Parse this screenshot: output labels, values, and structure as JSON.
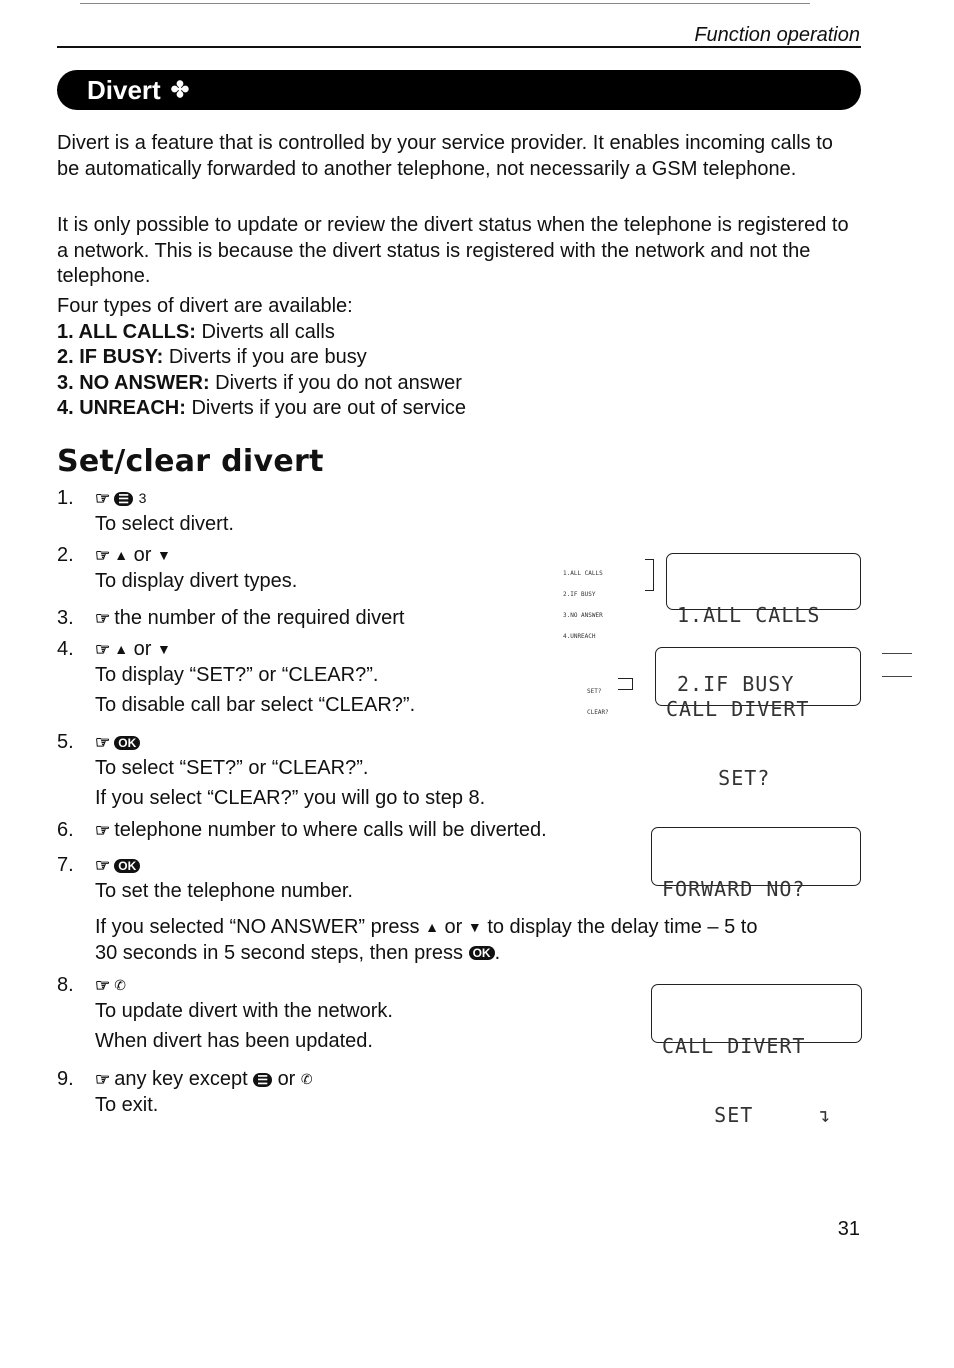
{
  "header": {
    "section": "Function operation",
    "banner_title": "Divert",
    "banner_icon": "divert-icon"
  },
  "intro": {
    "p1": "Divert is a feature that is controlled by your service provider. It enables incoming calls to be automatically forwarded to another telephone, not necessarily a GSM telephone.",
    "p2": "It is only possible to update or review the divert status when the telephone is registered to a network. This is because the divert status is registered with the network and not the telephone.",
    "types_intro": "Four types of divert are available:",
    "types": [
      {
        "label": "1. ALL CALLS:",
        "desc": "Diverts all calls"
      },
      {
        "label": "2. IF BUSY:",
        "desc": "Diverts if you are busy"
      },
      {
        "label": "3. NO ANSWER:",
        "desc": "Diverts if you do not answer"
      },
      {
        "label": "4. UNREACH:",
        "desc": "Diverts if you are out of service"
      }
    ]
  },
  "section": {
    "title": "Set/clear divert"
  },
  "keys": {
    "hand": "☞",
    "menu": "☰",
    "three": "3",
    "up": "▲",
    "down": "▼",
    "ok": "OK",
    "send": "✆",
    "or": "or"
  },
  "steps": [
    {
      "num": "1.",
      "lines": [
        "To select divert."
      ]
    },
    {
      "num": "2.",
      "lines": [
        "To display divert types."
      ]
    },
    {
      "num": "3.",
      "lines": [
        "the number of the required divert"
      ]
    },
    {
      "num": "4.",
      "lines": [
        "To display “SET?” or “CLEAR?”.",
        "To disable call bar select “CLEAR?”."
      ]
    },
    {
      "num": "5.",
      "lines": [
        "To select “SET?” or “CLEAR?”.",
        "If you select “CLEAR?” you will go to step 8."
      ]
    },
    {
      "num": "6.",
      "lines": [
        "telephone number to where calls will be diverted."
      ]
    },
    {
      "num": "7.",
      "lines": [
        "To set the telephone number.",
        "If you selected “NO ANSWER” press",
        "or",
        "to display the delay time – 5 to",
        "30 seconds in 5 second steps, then press"
      ]
    },
    {
      "num": "8.",
      "lines": [
        "To update divert with the network.",
        "When divert has been updated."
      ]
    },
    {
      "num": "9.",
      "lines": [
        "any key except",
        "or",
        "To exit."
      ]
    }
  ],
  "displays": {
    "types": {
      "line1": "1.ALL CALLS",
      "line2": "2.IF BUSY",
      "mini": [
        "1.ALL CALLS",
        "2.IF BUSY",
        "3.NO ANSWER",
        "4.UNREACH"
      ]
    },
    "set": {
      "line1": "CALL DIVERT",
      "line2": "    SET?",
      "mini": [
        "SET?",
        "CLEAR?"
      ]
    },
    "forward": {
      "line1": "FORWARD NO?",
      "line2": ""
    },
    "done": {
      "line1": "CALL DIVERT",
      "line2": "    SET     ↴"
    }
  },
  "footer": {
    "page_number": "31"
  }
}
